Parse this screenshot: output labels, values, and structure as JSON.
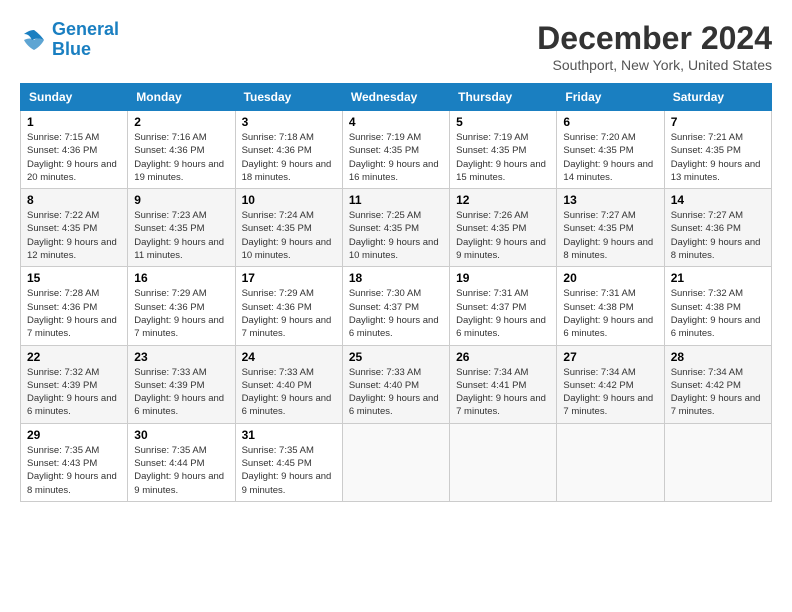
{
  "header": {
    "logo": {
      "line1": "General",
      "line2": "Blue"
    },
    "title": "December 2024",
    "location": "Southport, New York, United States"
  },
  "days_of_week": [
    "Sunday",
    "Monday",
    "Tuesday",
    "Wednesday",
    "Thursday",
    "Friday",
    "Saturday"
  ],
  "weeks": [
    [
      {
        "day": "1",
        "sunrise": "7:15 AM",
        "sunset": "4:36 PM",
        "daylight": "9 hours and 20 minutes."
      },
      {
        "day": "2",
        "sunrise": "7:16 AM",
        "sunset": "4:36 PM",
        "daylight": "9 hours and 19 minutes."
      },
      {
        "day": "3",
        "sunrise": "7:18 AM",
        "sunset": "4:36 PM",
        "daylight": "9 hours and 18 minutes."
      },
      {
        "day": "4",
        "sunrise": "7:19 AM",
        "sunset": "4:35 PM",
        "daylight": "9 hours and 16 minutes."
      },
      {
        "day": "5",
        "sunrise": "7:19 AM",
        "sunset": "4:35 PM",
        "daylight": "9 hours and 15 minutes."
      },
      {
        "day": "6",
        "sunrise": "7:20 AM",
        "sunset": "4:35 PM",
        "daylight": "9 hours and 14 minutes."
      },
      {
        "day": "7",
        "sunrise": "7:21 AM",
        "sunset": "4:35 PM",
        "daylight": "9 hours and 13 minutes."
      }
    ],
    [
      {
        "day": "8",
        "sunrise": "7:22 AM",
        "sunset": "4:35 PM",
        "daylight": "9 hours and 12 minutes."
      },
      {
        "day": "9",
        "sunrise": "7:23 AM",
        "sunset": "4:35 PM",
        "daylight": "9 hours and 11 minutes."
      },
      {
        "day": "10",
        "sunrise": "7:24 AM",
        "sunset": "4:35 PM",
        "daylight": "9 hours and 10 minutes."
      },
      {
        "day": "11",
        "sunrise": "7:25 AM",
        "sunset": "4:35 PM",
        "daylight": "9 hours and 10 minutes."
      },
      {
        "day": "12",
        "sunrise": "7:26 AM",
        "sunset": "4:35 PM",
        "daylight": "9 hours and 9 minutes."
      },
      {
        "day": "13",
        "sunrise": "7:27 AM",
        "sunset": "4:35 PM",
        "daylight": "9 hours and 8 minutes."
      },
      {
        "day": "14",
        "sunrise": "7:27 AM",
        "sunset": "4:36 PM",
        "daylight": "9 hours and 8 minutes."
      }
    ],
    [
      {
        "day": "15",
        "sunrise": "7:28 AM",
        "sunset": "4:36 PM",
        "daylight": "9 hours and 7 minutes."
      },
      {
        "day": "16",
        "sunrise": "7:29 AM",
        "sunset": "4:36 PM",
        "daylight": "9 hours and 7 minutes."
      },
      {
        "day": "17",
        "sunrise": "7:29 AM",
        "sunset": "4:36 PM",
        "daylight": "9 hours and 7 minutes."
      },
      {
        "day": "18",
        "sunrise": "7:30 AM",
        "sunset": "4:37 PM",
        "daylight": "9 hours and 6 minutes."
      },
      {
        "day": "19",
        "sunrise": "7:31 AM",
        "sunset": "4:37 PM",
        "daylight": "9 hours and 6 minutes."
      },
      {
        "day": "20",
        "sunrise": "7:31 AM",
        "sunset": "4:38 PM",
        "daylight": "9 hours and 6 minutes."
      },
      {
        "day": "21",
        "sunrise": "7:32 AM",
        "sunset": "4:38 PM",
        "daylight": "9 hours and 6 minutes."
      }
    ],
    [
      {
        "day": "22",
        "sunrise": "7:32 AM",
        "sunset": "4:39 PM",
        "daylight": "9 hours and 6 minutes."
      },
      {
        "day": "23",
        "sunrise": "7:33 AM",
        "sunset": "4:39 PM",
        "daylight": "9 hours and 6 minutes."
      },
      {
        "day": "24",
        "sunrise": "7:33 AM",
        "sunset": "4:40 PM",
        "daylight": "9 hours and 6 minutes."
      },
      {
        "day": "25",
        "sunrise": "7:33 AM",
        "sunset": "4:40 PM",
        "daylight": "9 hours and 6 minutes."
      },
      {
        "day": "26",
        "sunrise": "7:34 AM",
        "sunset": "4:41 PM",
        "daylight": "9 hours and 7 minutes."
      },
      {
        "day": "27",
        "sunrise": "7:34 AM",
        "sunset": "4:42 PM",
        "daylight": "9 hours and 7 minutes."
      },
      {
        "day": "28",
        "sunrise": "7:34 AM",
        "sunset": "4:42 PM",
        "daylight": "9 hours and 7 minutes."
      }
    ],
    [
      {
        "day": "29",
        "sunrise": "7:35 AM",
        "sunset": "4:43 PM",
        "daylight": "9 hours and 8 minutes."
      },
      {
        "day": "30",
        "sunrise": "7:35 AM",
        "sunset": "4:44 PM",
        "daylight": "9 hours and 9 minutes."
      },
      {
        "day": "31",
        "sunrise": "7:35 AM",
        "sunset": "4:45 PM",
        "daylight": "9 hours and 9 minutes."
      },
      null,
      null,
      null,
      null
    ]
  ],
  "labels": {
    "sunrise": "Sunrise:",
    "sunset": "Sunset:",
    "daylight": "Daylight:"
  }
}
